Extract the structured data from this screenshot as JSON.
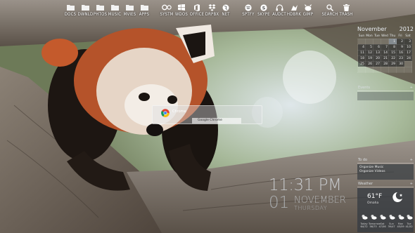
{
  "dock": {
    "items": [
      {
        "label": "DOCS",
        "icon": "folder-icon"
      },
      {
        "label": "DWNLD",
        "icon": "folder-icon"
      },
      {
        "label": "PHTOS",
        "icon": "folder-icon"
      },
      {
        "label": "MUSIC",
        "icon": "folder-icon"
      },
      {
        "label": "MVIES",
        "icon": "folder-icon"
      },
      {
        "label": "APPS",
        "icon": "folder-icon"
      },
      {
        "label": "SYSTM",
        "icon": "system-icon"
      },
      {
        "label": "WDOS",
        "icon": "windows-icon"
      },
      {
        "label": "OFFICE",
        "icon": "office-icon"
      },
      {
        "label": "DRPBX",
        "icon": "dropbox-icon"
      },
      {
        "label": "NET",
        "icon": "network-icon"
      },
      {
        "label": "SPTFY",
        "icon": "spotify-icon"
      },
      {
        "label": "SKYPE",
        "icon": "skype-icon"
      },
      {
        "label": "AUDCT",
        "icon": "audacity-icon"
      },
      {
        "label": "HDBRK",
        "icon": "handbrake-icon"
      },
      {
        "label": "GIMP",
        "icon": "gimp-icon"
      },
      {
        "label": "SEARCH",
        "icon": "search-icon"
      },
      {
        "label": "TRASH",
        "icon": "trash-icon"
      }
    ]
  },
  "calendar": {
    "month": "November",
    "year": "2012",
    "weekdays": [
      "Sun",
      "Mon",
      "Tue",
      "Wed",
      "Thu",
      "Fri",
      "Sat"
    ],
    "weeks": [
      [
        "",
        "",
        "",
        "",
        "1",
        "2",
        "3"
      ],
      [
        "4",
        "5",
        "6",
        "7",
        "8",
        "9",
        "10"
      ],
      [
        "11",
        "12",
        "13",
        "14",
        "15",
        "16",
        "17"
      ],
      [
        "18",
        "19",
        "20",
        "21",
        "22",
        "23",
        "24"
      ],
      [
        "25",
        "26",
        "27",
        "28",
        "29",
        "30",
        ""
      ],
      [
        "",
        "",
        "",
        "",
        "",
        "",
        ""
      ]
    ],
    "today": "1"
  },
  "events": {
    "title": "Events",
    "action": "+"
  },
  "todo": {
    "title": "To do",
    "action": "+",
    "items": [
      "Organize Music",
      "Organize Videos"
    ]
  },
  "weather": {
    "title": "Weather",
    "action": "+",
    "temp": "61°F",
    "city": "Omaha",
    "forecast": [
      {
        "day": "Today",
        "temp": "64/72"
      },
      {
        "day": "Tomorrow",
        "temp": "56/73"
      },
      {
        "day": "Sat",
        "temp": "47/56"
      },
      {
        "day": "Sun",
        "temp": "39/47"
      },
      {
        "day": "Mon",
        "temp": "45/59"
      },
      {
        "day": "Tue",
        "temp": "41/52"
      }
    ]
  },
  "clock": {
    "time": "11:31 PM",
    "day": "01",
    "month": "NOVEMBER",
    "weekday": "THURSDAY"
  },
  "launcher": {
    "query": "Chrome",
    "result": "Google Chrome"
  },
  "colors": {
    "accent": "#e8edf2",
    "widget_bg": "#2c3035"
  }
}
